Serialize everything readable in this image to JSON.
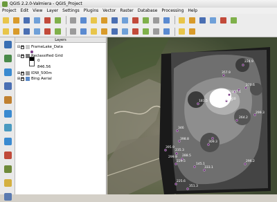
{
  "window": {
    "title": "QGIS 2.2.0-Valmiera - QGIS_Project"
  },
  "menu": [
    "Project",
    "Edit",
    "View",
    "Layer",
    "Settings",
    "Plugins",
    "Vector",
    "Raster",
    "Database",
    "Processing",
    "Help"
  ],
  "toolbar1_icons": [
    "new-project-icon",
    "open-project-icon",
    "save-project-icon",
    "save-as-icon",
    "print-composer-icon",
    "composer-manager-icon",
    "pan-icon",
    "pan-to-selection-icon",
    "zoom-in-icon",
    "zoom-out-icon",
    "zoom-actual-icon",
    "zoom-full-icon",
    "zoom-layer-icon",
    "zoom-selection-icon",
    "zoom-last-icon",
    "zoom-next-icon",
    "refresh-icon",
    "identify-icon",
    "select-icon",
    "measure-icon",
    "annotation-icon",
    "map-tips-icon"
  ],
  "toolbar2_icons": [
    "digitize-icon",
    "toggle-edit-icon",
    "save-edits-icon",
    "add-feature-icon",
    "move-feature-icon",
    "node-tool-icon",
    "delete-icon",
    "cut-icon",
    "copy-icon",
    "paste-icon",
    "undo-icon",
    "redo-icon",
    "label-icon",
    "label-pin-icon",
    "label-show-icon",
    "label-move-icon",
    "label-rotate-icon",
    "label-change-icon"
  ],
  "left_tools": [
    "add-vector-layer-icon",
    "add-raster-layer-icon",
    "add-postgis-layer-icon",
    "add-spatialite-layer-icon",
    "add-mssql-layer-icon",
    "add-wms-layer-icon",
    "add-wcs-layer-icon",
    "add-wfs-layer-icon",
    "add-oracle-layer-icon",
    "add-delimited-text-icon",
    "new-shapefile-icon",
    "new-spatialite-icon"
  ],
  "layers_panel": {
    "header": "Layers",
    "layers": [
      {
        "name": "FrameLake_Data",
        "checked": true,
        "expanded": true
      },
      {
        "name": "Reclassified Grid",
        "checked": true,
        "expanded": true,
        "legend": [
          "0",
          "846.56"
        ]
      },
      {
        "name": "IDW_500m",
        "checked": true,
        "expanded": false
      },
      {
        "name": "Bing Aerial",
        "checked": true,
        "expanded": false
      }
    ]
  },
  "map_labels": [
    "357.9",
    "224.9",
    "337.1",
    "270.6",
    "181.5",
    "310",
    "227.5",
    "264.2",
    "299.3",
    "346",
    "398.8",
    "309.3",
    "395.9",
    "235.3",
    "288.5",
    "229.5",
    "299.9",
    "145.1",
    "333.1",
    "296.2",
    "351.3",
    "225.6"
  ]
}
